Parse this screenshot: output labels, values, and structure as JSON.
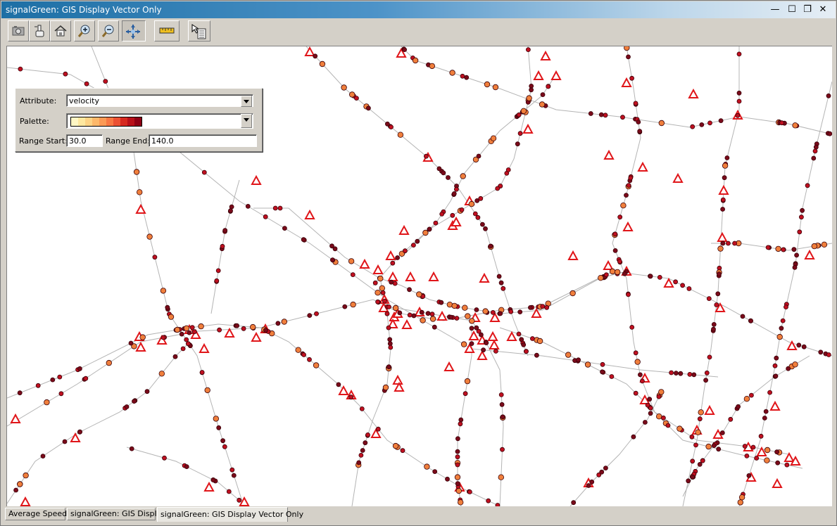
{
  "window": {
    "title": "signalGreen: GIS Display Vector Only",
    "controls": {
      "minimize": "—",
      "maximize": "☐",
      "restore": "❐",
      "close": "✕"
    }
  },
  "toolbar": {
    "buttons": [
      {
        "name": "camera-button",
        "icon": "camera-icon"
      },
      {
        "name": "touch-button",
        "icon": "hand-touch-icon"
      },
      {
        "name": "home-button",
        "icon": "home-icon"
      },
      {
        "name": "zoom-in-button",
        "icon": "zoom-in-icon"
      },
      {
        "name": "zoom-out-button",
        "icon": "zoom-out-icon"
      },
      {
        "name": "pan-button",
        "icon": "pan-arrows-icon",
        "pressed": true
      },
      {
        "name": "measure-button",
        "icon": "ruler-icon"
      },
      {
        "name": "select-info-button",
        "icon": "pointer-list-icon"
      }
    ]
  },
  "panel": {
    "attribute_label": "Attribute:",
    "attribute_value": "velocity",
    "palette_label": "Palette:",
    "palette_colors": [
      "#fff7c4",
      "#fee8a0",
      "#fdd385",
      "#fdb86a",
      "#fc9a55",
      "#f87843",
      "#ec5133",
      "#d6291f",
      "#b81019",
      "#8e0014"
    ],
    "range_start_label": "Range Start:",
    "range_start_value": "30.0",
    "range_end_label": "Range End:",
    "range_end_value": "140.0"
  },
  "map": {
    "road_color": "#b4b4b4",
    "signal_color": "#e0161a",
    "point_colors": {
      "slow": "#f07f3c",
      "mid": "#c01020",
      "fast": "#7a0a1a"
    }
  },
  "tabs": [
    {
      "label": "Average Speed",
      "active": false
    },
    {
      "label": "signalGreen: GIS Display",
      "active": false
    },
    {
      "label": "signalGreen: GIS Display Vector Only",
      "active": true
    }
  ]
}
